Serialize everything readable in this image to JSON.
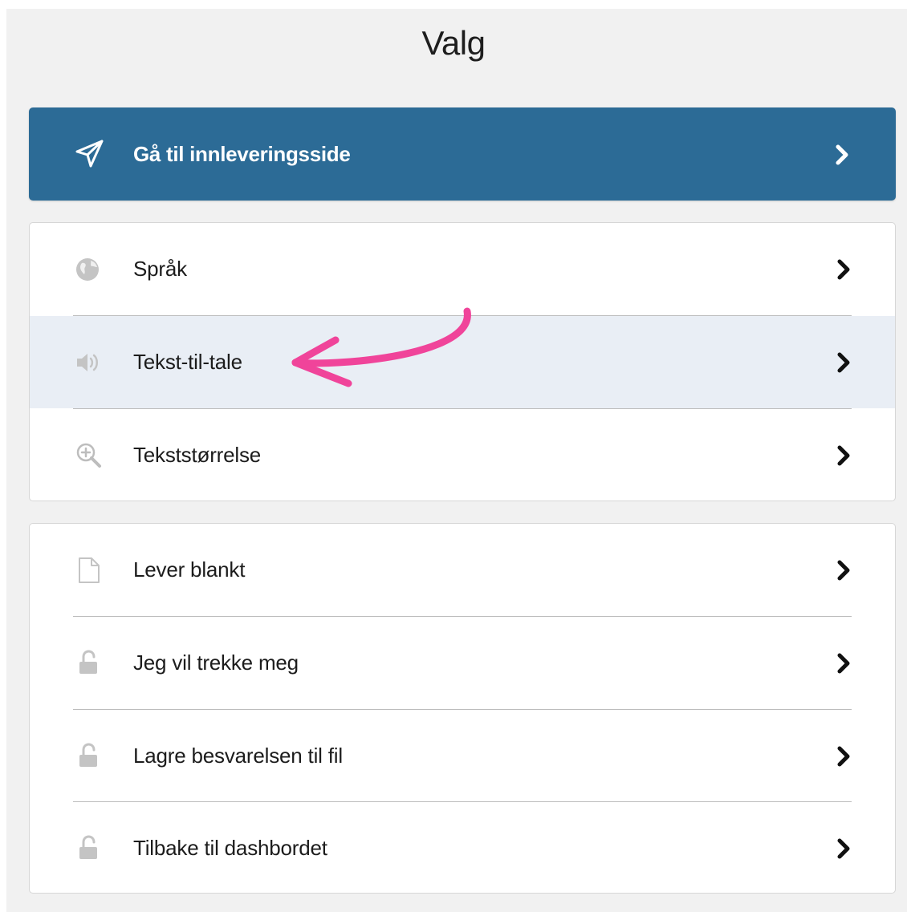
{
  "title": "Valg",
  "primary_action": {
    "label": "Gå til innleveringsside",
    "icon": "paper-plane-icon"
  },
  "settings_card": {
    "items": [
      {
        "label": "Språk",
        "icon": "globe-icon"
      },
      {
        "label": "Tekst-til-tale",
        "icon": "speaker-icon",
        "highlighted": true
      },
      {
        "label": "Tekststørrelse",
        "icon": "zoom-in-icon"
      }
    ]
  },
  "actions_card": {
    "items": [
      {
        "label": "Lever blankt",
        "icon": "blank-document-icon"
      },
      {
        "label": "Jeg vil trekke meg",
        "icon": "unlock-icon"
      },
      {
        "label": "Lagre besvarelsen til fil",
        "icon": "unlock-icon"
      },
      {
        "label": "Tilbake til dashbordet",
        "icon": "unlock-icon"
      }
    ]
  },
  "colors": {
    "primary": "#2c6b96",
    "highlight_row": "#e9eef5",
    "annotation_arrow": "#f0449a",
    "background": "#f1f1f1"
  }
}
